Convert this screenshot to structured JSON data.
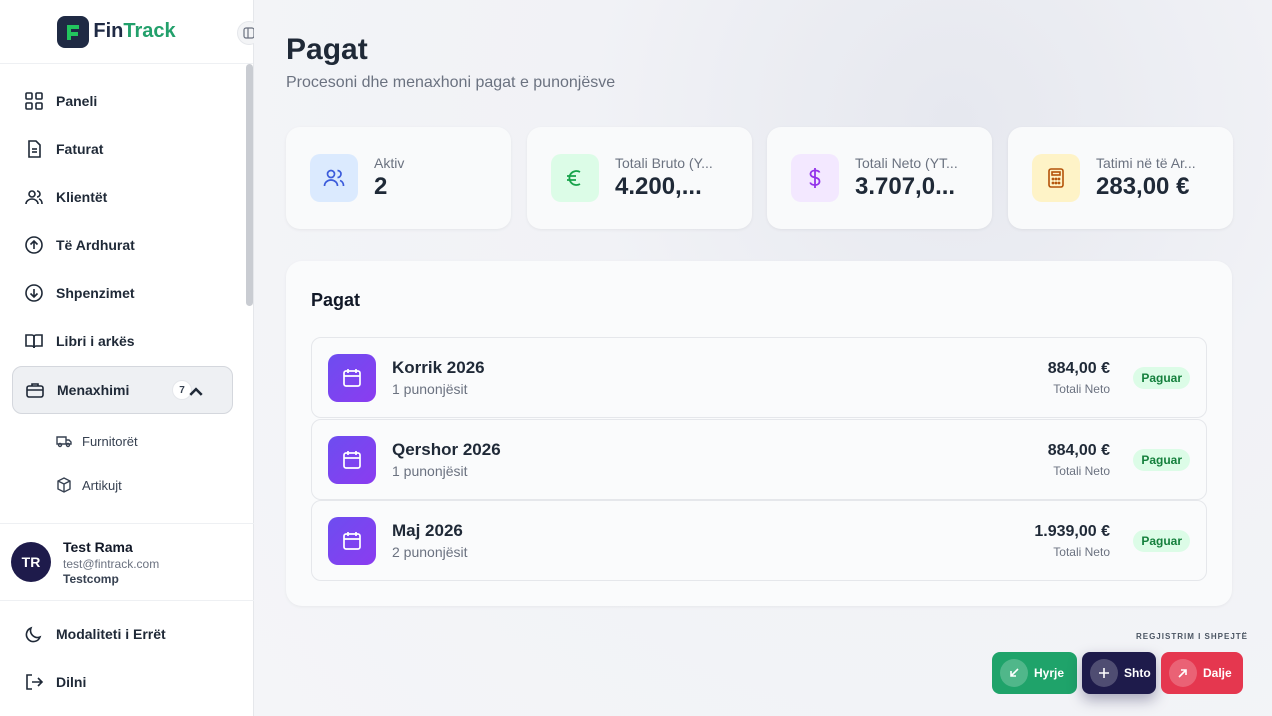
{
  "brand": {
    "name_part1": "Fin",
    "name_part2": "Track"
  },
  "sidebar": {
    "items": [
      {
        "label": "Paneli",
        "icon": "dashboard-icon"
      },
      {
        "label": "Faturat",
        "icon": "document-icon"
      },
      {
        "label": "Klientët",
        "icon": "users-icon"
      },
      {
        "label": "Të Ardhurat",
        "icon": "arrow-up-circle-icon"
      },
      {
        "label": "Shpenzimet",
        "icon": "arrow-down-circle-icon"
      },
      {
        "label": "Libri i arkës",
        "icon": "book-icon"
      }
    ],
    "management": {
      "label": "Menaxhimi",
      "count": "7",
      "icon": "briefcase-icon"
    },
    "sub_items": [
      {
        "label": "Furnitorët",
        "icon": "truck-icon"
      },
      {
        "label": "Artikujt",
        "icon": "box-icon"
      }
    ],
    "user": {
      "initials": "TR",
      "name": "Test Rama",
      "email": "test@fintrack.com",
      "company": "Testcomp"
    },
    "dark_mode_label": "Modaliteti i Errët",
    "logout_label": "Dilni"
  },
  "page": {
    "title": "Pagat",
    "subtitle": "Procesoni dhe menaxhoni pagat e punonjësve"
  },
  "stats": [
    {
      "label": "Aktiv",
      "value": "2",
      "icon": "users-icon",
      "color": "#dbeafe"
    },
    {
      "label": "Totali Bruto (Y...",
      "value": "4.200,...",
      "icon": "euro-icon",
      "color": "#dcfce7"
    },
    {
      "label": "Totali Neto (YT...",
      "value": "3.707,0...",
      "icon": "dollar-icon",
      "color": "#f3e8ff"
    },
    {
      "label": "Tatimi në të Ar...",
      "value": "283,00 €",
      "icon": "calculator-icon",
      "color": "#fef3c7"
    }
  ],
  "payroll": {
    "title": "Pagat",
    "rows": [
      {
        "period": "Korrik 2026",
        "employees": "1 punonjësit",
        "amount": "884,00 €",
        "amount_label": "Totali Neto",
        "status": "Paguar"
      },
      {
        "period": "Qershor 2026",
        "employees": "1 punonjësit",
        "amount": "884,00 €",
        "amount_label": "Totali Neto",
        "status": "Paguar"
      },
      {
        "period": "Maj 2026",
        "employees": "2 punonjësit",
        "amount": "1.939,00 €",
        "amount_label": "Totali Neto",
        "status": "Paguar"
      }
    ]
  },
  "quick": {
    "label": "REGJISTRIM I SHPEJTË",
    "in": "Hyrje",
    "add": "Shto",
    "out": "Dalje"
  }
}
